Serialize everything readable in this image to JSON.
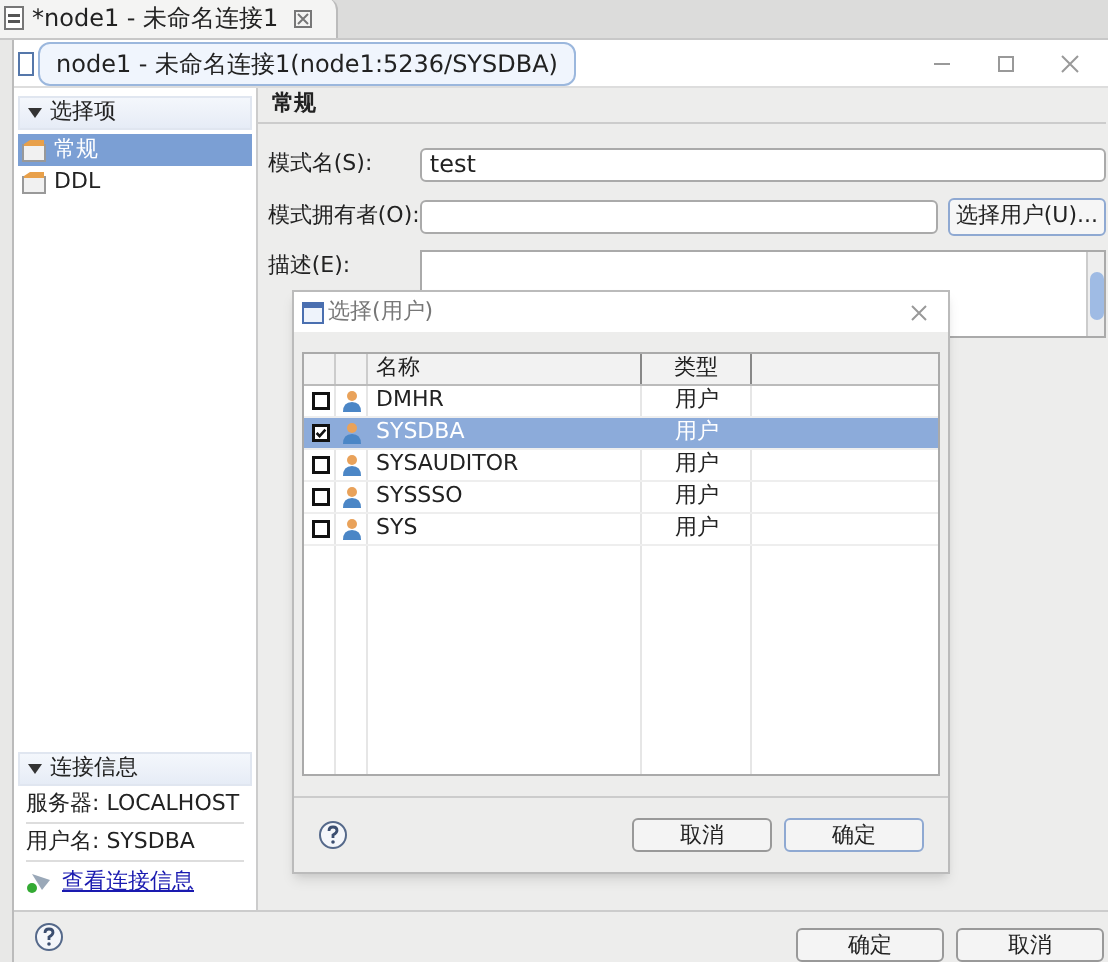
{
  "editor_tab": {
    "title": "*node1 - 未命名连接1"
  },
  "window": {
    "tooltip": "node1 - 未命名连接1(node1:5236/SYSDBA)"
  },
  "sidebar": {
    "title": "选择项",
    "items": [
      {
        "label": "常规",
        "selected": true
      },
      {
        "label": "DDL",
        "selected": false
      }
    ]
  },
  "connection_info": {
    "title": "连接信息",
    "lines": [
      "服务器: LOCALHOST",
      "用户名: SYSDBA"
    ],
    "link": "查看连接信息"
  },
  "form": {
    "title": "常规",
    "schema_name": {
      "label": "模式名(S):",
      "value": "test"
    },
    "owner": {
      "label": "模式拥有者(O):",
      "button": "选择用户(U)..."
    },
    "description": {
      "label": "描述(E):"
    }
  },
  "dialog": {
    "title": "选择(用户)",
    "columns": [
      "名称",
      "类型"
    ],
    "rows": [
      {
        "name": "DMHR",
        "type": "用户",
        "checked": false,
        "selected": false
      },
      {
        "name": "SYSDBA",
        "type": "用户",
        "checked": true,
        "selected": true
      },
      {
        "name": "SYSAUDITOR",
        "type": "用户",
        "checked": false,
        "selected": false
      },
      {
        "name": "SYSSSO",
        "type": "用户",
        "checked": false,
        "selected": false
      },
      {
        "name": "SYS",
        "type": "用户",
        "checked": false,
        "selected": false
      }
    ],
    "buttons": [
      "取消",
      "确定"
    ]
  },
  "buttons": [
    "确定",
    "取消"
  ]
}
